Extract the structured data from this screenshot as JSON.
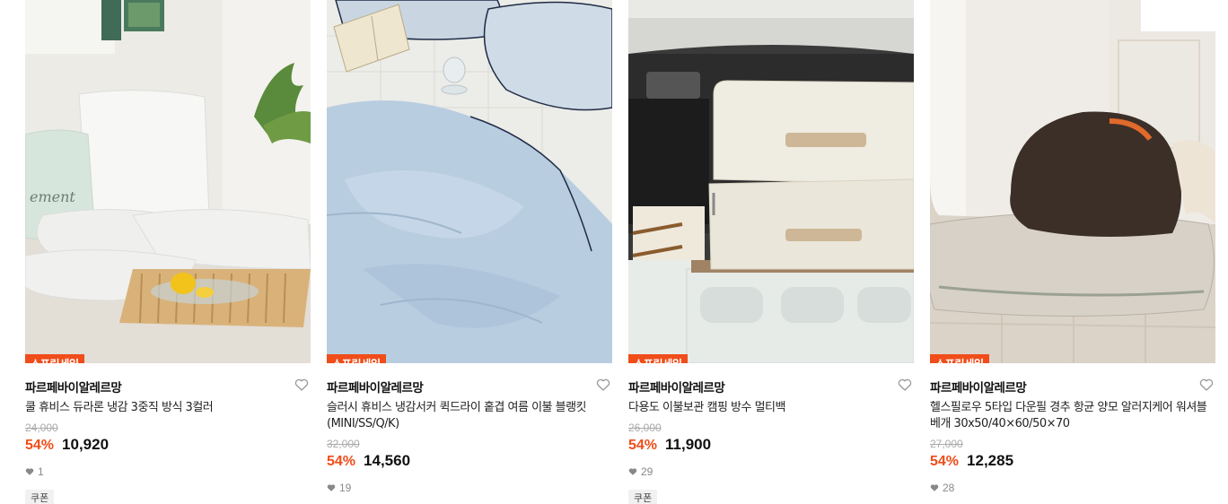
{
  "products": [
    {
      "badge": "스프링세일",
      "brand": "파르페바이알레르망",
      "title": "쿨 휴비스 듀라론 냉감 3중직 방식 3컬러",
      "original_price": "24,000",
      "discount": "54%",
      "price": "10,920",
      "likes": "1",
      "coupon": "쿠폰",
      "image": "pillows-on-floor"
    },
    {
      "badge": "스프링세일",
      "brand": "파르페바이알레르망",
      "title": "슬러시 휴비스 냉감서커 퀵드라이 홑겹 여름 이불 블랭킷(MINI/SS/Q/K)",
      "original_price": "32,000",
      "discount": "54%",
      "price": "14,560",
      "likes": "19",
      "coupon": "",
      "image": "blue-blanket"
    },
    {
      "badge": "스프링세일",
      "brand": "파르페바이알레르망",
      "title": "다용도 이불보관 캠핑 방수 멀티백",
      "original_price": "26,000",
      "discount": "54%",
      "price": "11,900",
      "likes": "29",
      "coupon": "쿠폰",
      "image": "storage-bags-in-car"
    },
    {
      "badge": "스프링세일",
      "brand": "파르페바이알레르망",
      "title": "헬스필로우 5타입 다운필 경추 항균 양모 알러지케어 워셔블 베개 30x50/40×60/50×70",
      "original_price": "27,000",
      "discount": "54%",
      "price": "12,285",
      "likes": "28",
      "coupon": "",
      "image": "person-on-pillow"
    }
  ],
  "colors": {
    "accent": "#f04d1a",
    "muted": "#aaaaaa"
  }
}
